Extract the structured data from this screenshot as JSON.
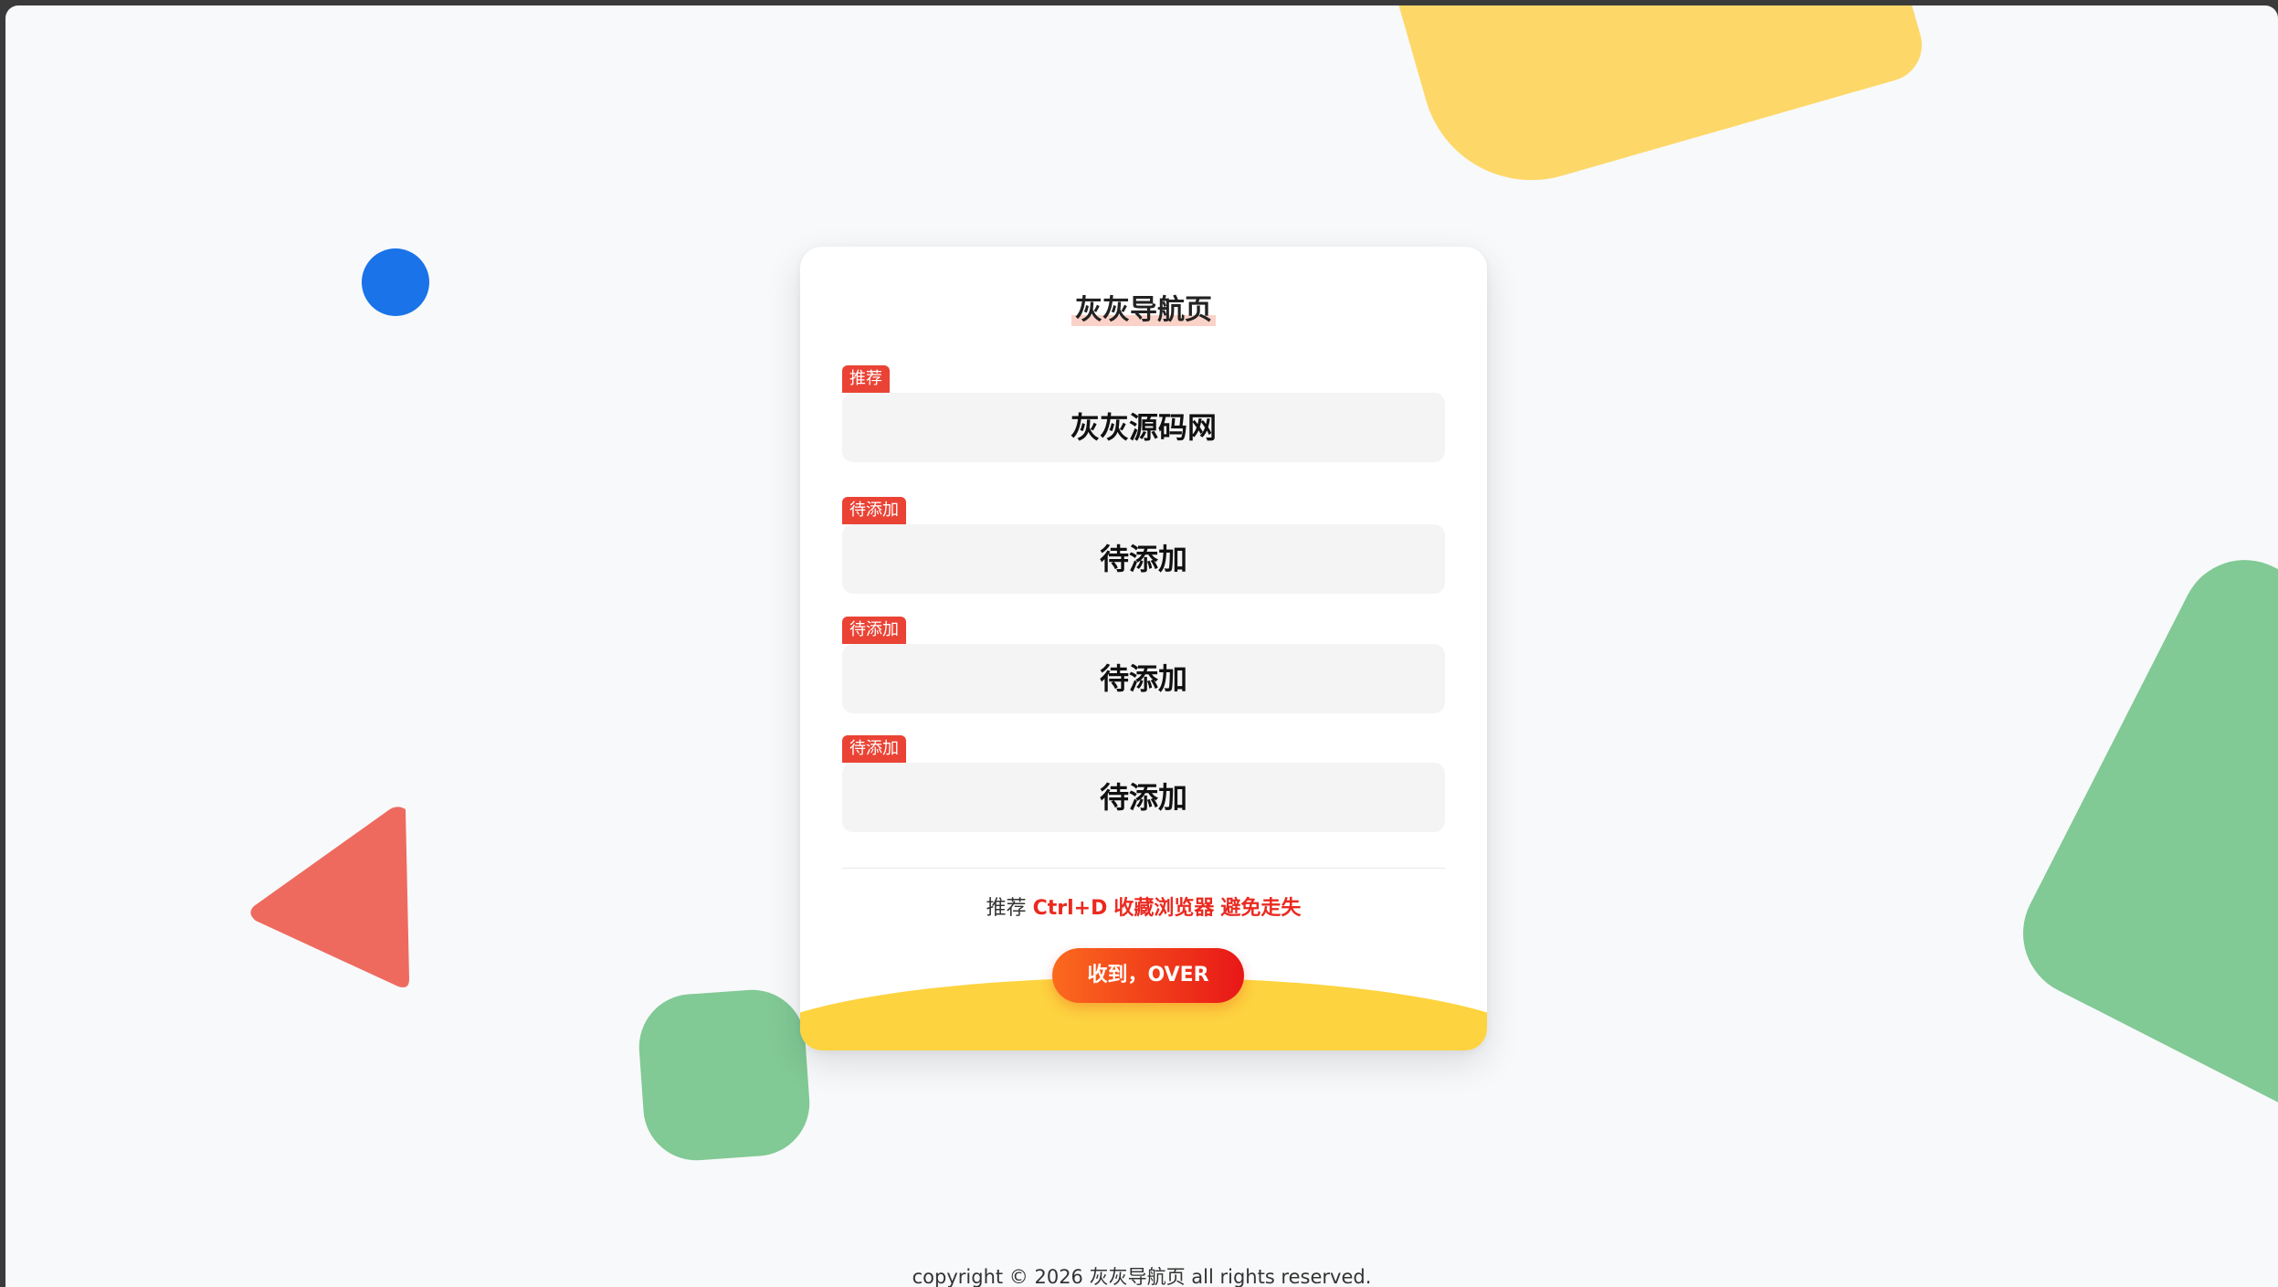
{
  "page": {
    "title": "灰灰导航页"
  },
  "links": [
    {
      "tag": "推荐",
      "label": "灰灰源码网"
    },
    {
      "tag": "待添加",
      "label": "待添加"
    },
    {
      "tag": "待添加",
      "label": "待添加"
    },
    {
      "tag": "待添加",
      "label": "待添加"
    }
  ],
  "tip": {
    "prefix": "推荐",
    "shortcut": "Ctrl+D",
    "action": "收藏浏览器",
    "suffix": "避免走失"
  },
  "confirm_button": {
    "label": "收到，OVER"
  },
  "footer": {
    "text": "copyright © 2026 灰灰导航页 all rights reserved."
  },
  "colors": {
    "tag_red": "#ea4335",
    "highlight_red": "#ea2a20",
    "wave_yellow": "#fdd33f",
    "shape_yellow": "#fdd869",
    "shape_blue": "#1a73e8",
    "shape_green": "#81c995",
    "shape_red": "#ee6a5f"
  }
}
